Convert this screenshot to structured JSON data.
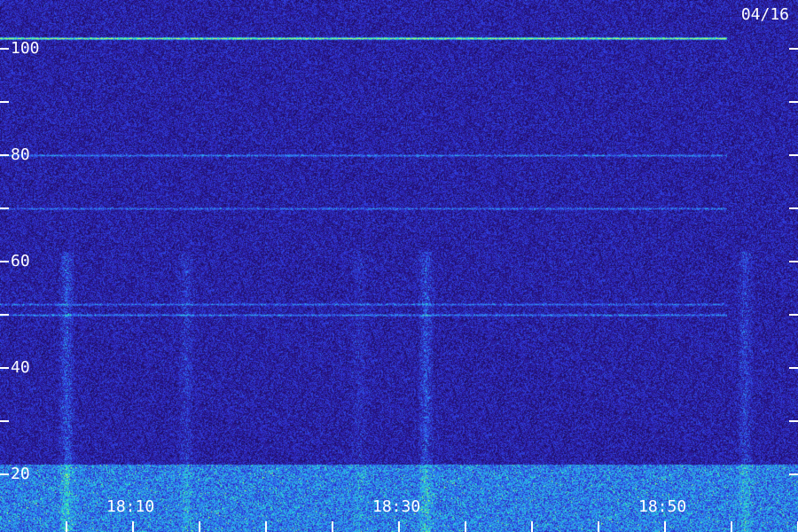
{
  "date_label": "04/16",
  "chart_data": {
    "type": "heatmap",
    "title": "",
    "xlabel": "",
    "ylabel": "",
    "x_ticks": [
      "18:10",
      "18:30",
      "18:50"
    ],
    "x_range_minutes": [
      18.0,
      18.93
    ],
    "y_ticks": [
      20,
      40,
      60,
      80,
      100
    ],
    "y_range": [
      10,
      107
    ],
    "colormap": [
      "#1a0a55",
      "#2a1890",
      "#2f34d8",
      "#2f7df0",
      "#27c8e8",
      "#3cf0a0",
      "#c8ff50"
    ],
    "background_color": "#23106a",
    "tick_color": "#ffffff",
    "horizontal_lines": [
      {
        "y": 102,
        "intensity": 0.95
      },
      {
        "y": 80,
        "intensity": 0.35
      },
      {
        "y": 70,
        "intensity": 0.3
      },
      {
        "y": 52,
        "intensity": 0.3
      },
      {
        "y": 50,
        "intensity": 0.35
      }
    ],
    "vertical_bursts": [
      {
        "time": "18:05",
        "intensity": 0.55
      },
      {
        "time": "18:14",
        "intensity": 0.3
      },
      {
        "time": "18:27",
        "intensity": 0.2
      },
      {
        "time": "18:32",
        "intensity": 0.5
      },
      {
        "time": "18:56",
        "intensity": 0.4
      }
    ],
    "noise_band_top": 22
  }
}
